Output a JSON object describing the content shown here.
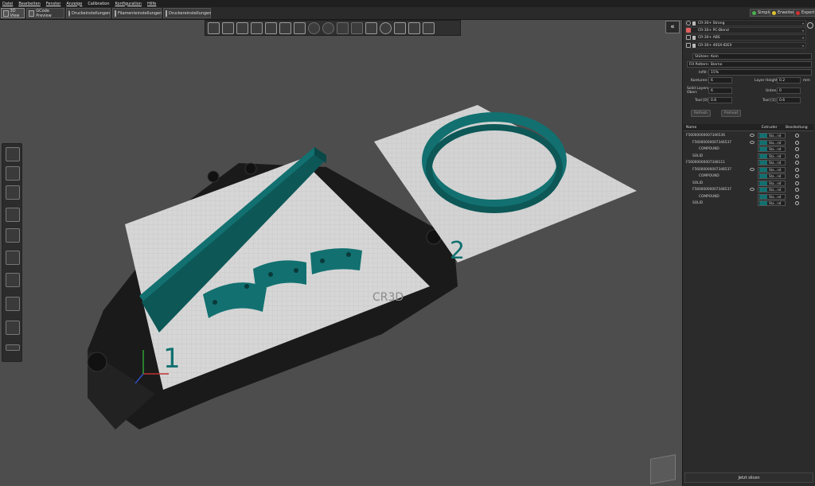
{
  "menu": [
    "Datei",
    "Bearbeiten",
    "Fenster",
    "Anzeige",
    "Calibration",
    "Konfiguration",
    "Hilfe"
  ],
  "tabs": [
    "3D View",
    "GCode Preview",
    "Druckeinstellungen",
    "Filamenteinstellungen",
    "Druckereinstellungen"
  ],
  "modes": {
    "simple": "Simple",
    "expert": "Erweitert",
    "export": "Expert"
  },
  "colors": {
    "model": "#127070",
    "plate": "#d6d6d6",
    "bg": "#4d4d4d"
  },
  "profiles": [
    {
      "name": "CR-30+ Strong",
      "icon": "circle-icon"
    },
    {
      "name": "CR-30+ PC-Blend",
      "icon": "color-swatch-icon"
    },
    {
      "name": "CR-30+ ABS",
      "icon": "filament-icon"
    },
    {
      "name": "CR-30+ 40SX-IDEX",
      "icon": "printer-icon"
    }
  ],
  "settings": {
    "supports_label": "Stützen: Kein",
    "fill_pattern_label": "Fill Pattern: Sterne",
    "infill_label": "Infill:",
    "infill_value": "15%",
    "konturen_label": "Konturen:",
    "konturen_value": "6",
    "layer_height_label": "Layer Height:",
    "layer_height_value": "0.2",
    "unit_mm": "mm",
    "solid_top_label": "Solid Layers Oben:",
    "solid_top_value": "6",
    "unten_label": "Unten:",
    "unten_value": "0",
    "tool0_label": "Tool [0]:",
    "tool0_value": "0.6",
    "tool1_label": "Tool [1]:",
    "tool1_value": "0.6",
    "refresh_label": "Refresh",
    "preheat_label": "Preheat"
  },
  "tree": {
    "col_name": "Name",
    "col_extruder": "Extruder",
    "col_edit": "Bearbeitung",
    "rows": [
      {
        "name": "F56000000007346536",
        "indent": 0,
        "eye": true,
        "ext": "Sta...nd"
      },
      {
        "name": "F56000000007346537",
        "indent": 1,
        "eye": true,
        "ext": "Sta...nd"
      },
      {
        "name": "COMPOUND",
        "indent": 2,
        "eye": false,
        "ext": "Sta...nd"
      },
      {
        "name": "SOLID",
        "indent": 1,
        "eye": false,
        "ext": "Sta...nd"
      },
      {
        "name": "F56000000007348111",
        "indent": 0,
        "eye": false,
        "ext": "Sta...nd"
      },
      {
        "name": "F56000000007348537",
        "indent": 1,
        "eye": true,
        "ext": "Sta...nd"
      },
      {
        "name": "COMPOUND",
        "indent": 2,
        "eye": false,
        "ext": "Sta...nd"
      },
      {
        "name": "SOLID",
        "indent": 1,
        "eye": false,
        "ext": "Sta...nd"
      },
      {
        "name": "F56000000007348537",
        "indent": 1,
        "eye": true,
        "ext": "Sta...nd"
      },
      {
        "name": "COMPOUND",
        "indent": 2,
        "eye": false,
        "ext": "Sta...nd"
      },
      {
        "name": "SOLID",
        "indent": 1,
        "eye": false,
        "ext": "Sta...nd"
      }
    ]
  },
  "slice_button": "Jetzt slicen",
  "bed_numbers": [
    "1",
    "2"
  ],
  "bed_logo": "CR3D"
}
